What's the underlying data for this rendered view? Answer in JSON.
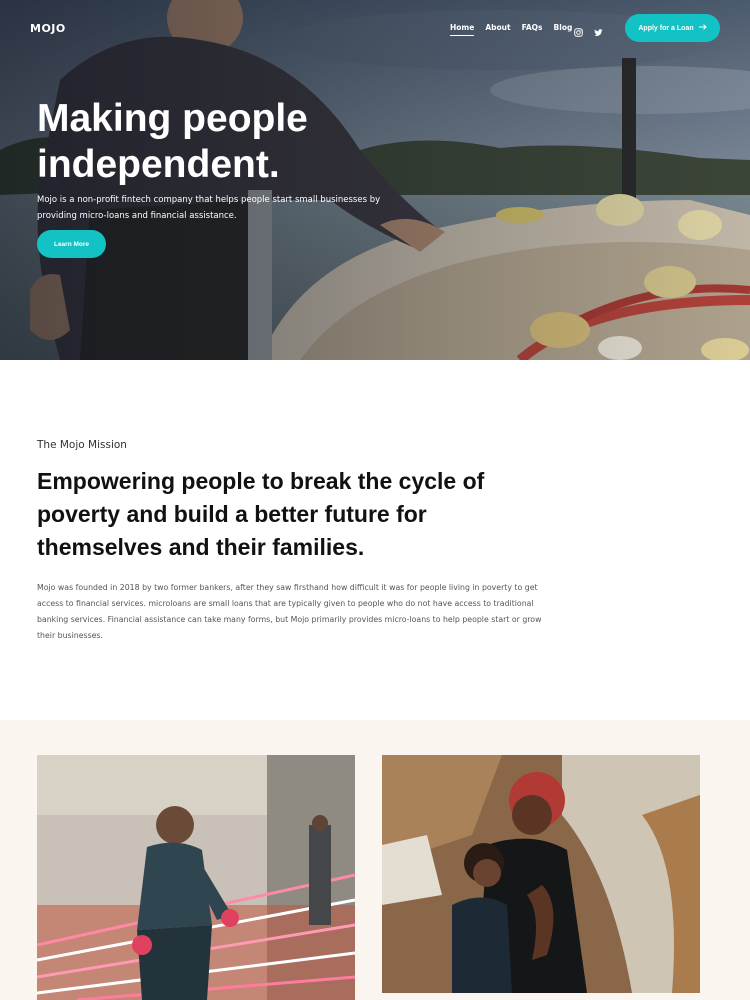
{
  "header": {
    "logo": "MOJO",
    "nav": [
      {
        "label": "Home",
        "active": true
      },
      {
        "label": "About",
        "active": false
      },
      {
        "label": "FAQs",
        "active": false
      },
      {
        "label": "Blog",
        "active": false
      }
    ],
    "social_icons": [
      "instagram-icon",
      "twitter-icon"
    ],
    "cta_label": "Apply for a Loan",
    "cta_icon": "arrow-right-icon"
  },
  "hero": {
    "title": "Making people independent.",
    "description": "Mojo is a non-profit fintech company that helps people start small businesses by providing micro-loans and financial assistance.",
    "button_label": "Learn More"
  },
  "mission": {
    "label": "The Mojo Mission",
    "title": "Empowering people to break the cycle of poverty and build a better future for themselves and their families.",
    "body": "Mojo was founded in 2018 by two former bankers, after they saw firsthand how difficult it was for people living in poverty to get access to financial services. microloans are small loans that are typically given to people who do not have access to traditional banking services. Financial assistance can take many forms, but Mojo primarily provides micro-loans to help people start or grow their businesses."
  },
  "colors": {
    "accent": "#12c2c4",
    "gallery_bg": "#faf6ef"
  }
}
